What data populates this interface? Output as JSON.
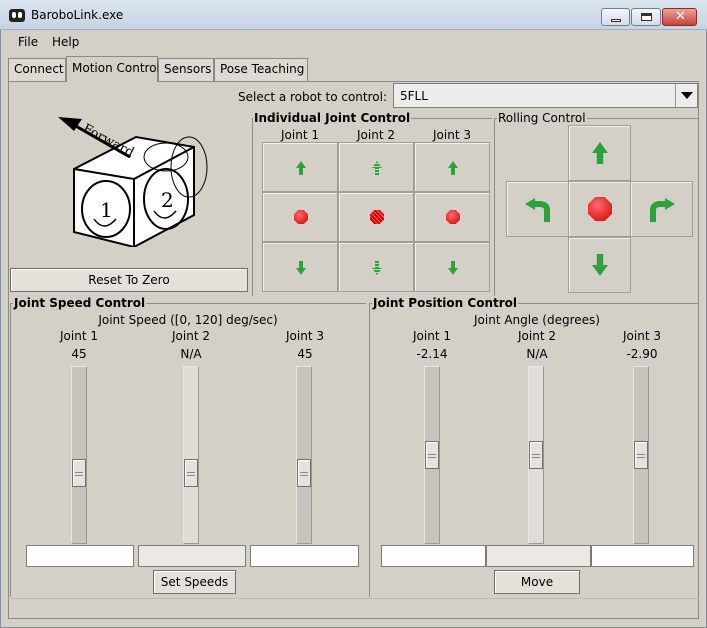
{
  "window": {
    "title": "BaroboLink.exe"
  },
  "menu": {
    "file": "File",
    "help": "Help"
  },
  "tabs": {
    "connect": "Connect",
    "motion": "Motion Control",
    "sensors": "Sensors",
    "pose": "Pose Teaching"
  },
  "robot_image": {
    "forward_label": "Forward",
    "joint1_label": "1",
    "joint2_label": "2"
  },
  "reset_button": "Reset To Zero",
  "robot_select": {
    "label": "Select a robot to control:",
    "value": "5FLL"
  },
  "individual": {
    "title": "Individual Joint Control",
    "headers": [
      "Joint 1",
      "Joint 2",
      "Joint 3"
    ]
  },
  "rolling": {
    "title": "Rolling Control"
  },
  "speed": {
    "title": "Joint Speed Control",
    "subtitle": "Joint Speed ([0, 120] deg/sec)",
    "joints": [
      {
        "label": "Joint 1",
        "value": "45",
        "enabled": true
      },
      {
        "label": "Joint 2",
        "value": "N/A",
        "enabled": false
      },
      {
        "label": "Joint 3",
        "value": "45",
        "enabled": true
      }
    ],
    "button": "Set Speeds"
  },
  "position": {
    "title": "Joint Position Control",
    "subtitle": "Joint Angle (degrees)",
    "joints": [
      {
        "label": "Joint 1",
        "value": "-2.14",
        "enabled": true
      },
      {
        "label": "Joint 2",
        "value": "N/A",
        "enabled": false
      },
      {
        "label": "Joint 3",
        "value": "-2.90",
        "enabled": true
      }
    ],
    "button": "Move"
  },
  "colors": {
    "go": "#2ea03c",
    "stop": "#d00000",
    "window_bg": "#d4d0c8"
  }
}
